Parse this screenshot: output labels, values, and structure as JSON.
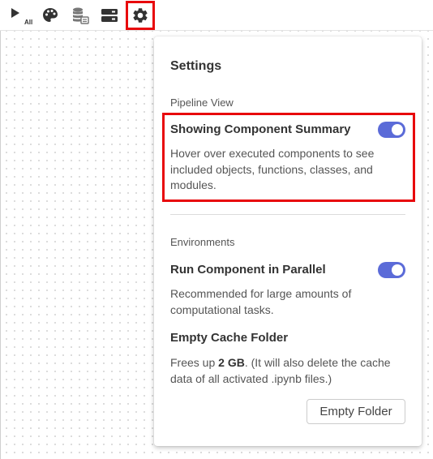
{
  "toolbar": {
    "run_all_label": "All",
    "icons": [
      "run-all-icon",
      "palette-icon",
      "database-icon",
      "server-icon",
      "gear-icon"
    ]
  },
  "settings": {
    "title": "Settings",
    "pipeline_view": {
      "heading": "Pipeline View",
      "component_summary": {
        "label": "Showing Component Summary",
        "enabled": true,
        "description": "Hover over executed components to see included objects, functions, classes, and modules."
      }
    },
    "environments": {
      "heading": "Environments",
      "run_parallel": {
        "label": "Run Component in Parallel",
        "enabled": true,
        "description": "Recommended for large amounts of computational tasks."
      },
      "empty_cache": {
        "label": "Empty Cache Folder",
        "desc_prefix": "Frees up ",
        "size": "2 GB",
        "desc_suffix": ". (It will also delete the cache data of all activated .ipynb files.)",
        "button_label": "Empty Folder"
      }
    }
  },
  "colors": {
    "accent": "#5b6bd8",
    "highlight": "#e8080c"
  }
}
